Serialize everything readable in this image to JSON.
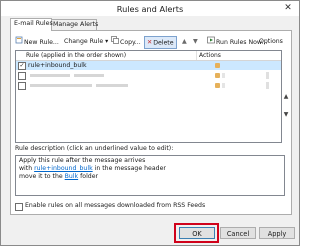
{
  "window": {
    "title": "Rules and Alerts",
    "close_glyph": "✕"
  },
  "tabs": [
    {
      "label": "E-mail Rules",
      "active": true
    },
    {
      "label": "Manage Alerts",
      "active": false
    }
  ],
  "toolbar": {
    "new_rule": "New Rule...",
    "change_rule": "Change Rule",
    "copy": "Copy...",
    "delete": "Delete",
    "move_up": "▲",
    "move_down": "▼",
    "run_rules": "Run Rules Now...",
    "options": "Options",
    "icons": [
      "new-rule-icon",
      "change-rule-icon",
      "copy-icon",
      "delete-icon",
      "move-up-icon",
      "move-down-icon",
      "run-rules-icon"
    ]
  },
  "rules_list": {
    "columns": [
      "Rule (applied in the order shown)",
      "Actions"
    ],
    "rows": [
      {
        "name": "rule+inbound_bulk",
        "checked": true,
        "selected": true
      },
      {
        "name": "",
        "checked": false,
        "selected": false
      },
      {
        "name": "",
        "checked": false,
        "selected": false
      }
    ]
  },
  "description": {
    "label": "Rule description (click an underlined value to edit):",
    "line1": "Apply this rule after the message arrives",
    "line2_prefix": "with ",
    "line2_link": "rule+inbound_bulk",
    "line2_suffix": " in the message header",
    "line3_prefix": "move it to the ",
    "line3_link": "Bulk",
    "line3_suffix": " folder"
  },
  "rss": {
    "label": "Enable rules on all messages downloaded from RSS Feeds",
    "checked": false
  },
  "buttons": {
    "ok": "OK",
    "cancel": "Cancel",
    "apply": "Apply"
  },
  "colors": {
    "selection": "#cce8ff",
    "link": "#0066cc",
    "highlight": "#d0021b"
  }
}
